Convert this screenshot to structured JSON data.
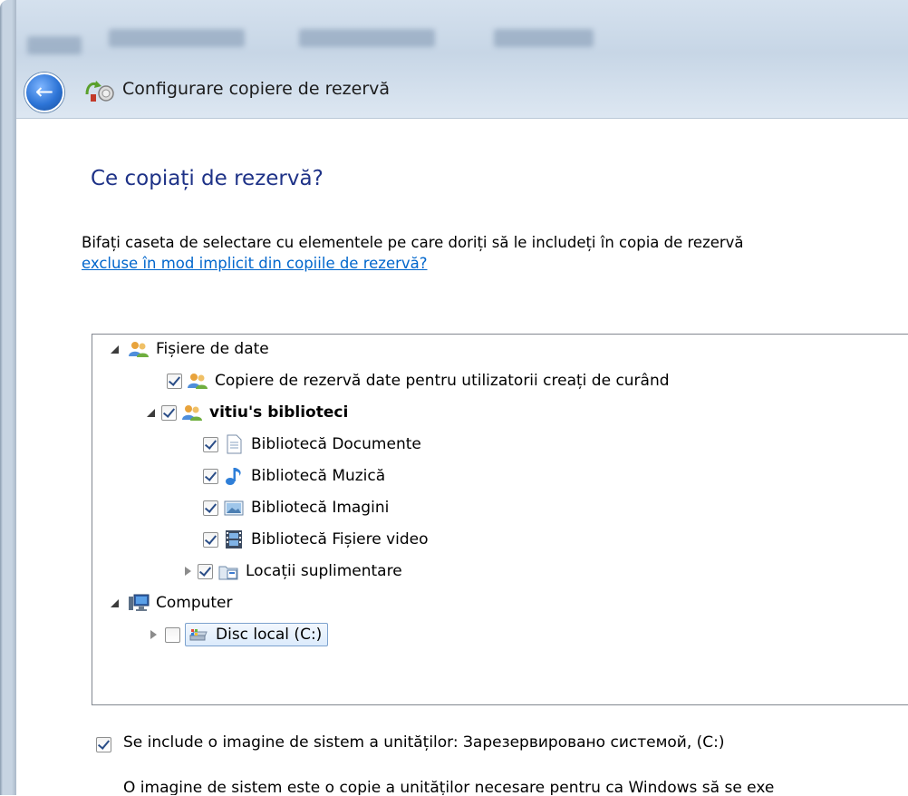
{
  "window": {
    "title": "Configurare copiere de rezervă",
    "background_blur_colors": [
      "#d5e1ee",
      "#c7d6e6"
    ]
  },
  "page": {
    "heading": "Ce copiați de rezervă?",
    "description_line1": "Bifați caseta de selectare cu elementele pe care doriți să le includeți în copia de rezervă",
    "description_link": "excluse în mod implicit din copiile de rezervă?"
  },
  "tree": {
    "items": [
      {
        "label": "Fișiere de date",
        "checked": null,
        "icon": "users-icon",
        "expander": "open"
      },
      {
        "label": "Copiere de rezervă date pentru utilizatorii creați de curând",
        "checked": true,
        "icon": "users-icon",
        "expander": "none"
      },
      {
        "label": "vitiu's biblioteci",
        "checked": true,
        "icon": "users-icon",
        "expander": "open"
      },
      {
        "label": "Bibliotecă Documente",
        "checked": true,
        "icon": "document-icon",
        "expander": "none"
      },
      {
        "label": "Bibliotecă Muzică",
        "checked": true,
        "icon": "music-note-icon",
        "expander": "none"
      },
      {
        "label": "Bibliotecă Imagini",
        "checked": true,
        "icon": "picture-icon",
        "expander": "none"
      },
      {
        "label": "Bibliotecă Fișiere video",
        "checked": true,
        "icon": "film-icon",
        "expander": "none"
      },
      {
        "label": "Locații suplimentare",
        "checked": true,
        "icon": "folder-locations-icon",
        "expander": "closed"
      },
      {
        "label": "Computer",
        "checked": null,
        "icon": "computer-icon",
        "expander": "open"
      },
      {
        "label": "Disc local (C:)",
        "checked": false,
        "icon": "drive-icon",
        "expander": "closed",
        "selected": true
      }
    ]
  },
  "options": {
    "system_image_label": "Se include o imagine de sistem a unităților: Зарезервировано системой, (C:)",
    "system_image_checked": true,
    "system_image_note": "O imagine de sistem este o copie a unităților necesare pentru ca Windows să se exe"
  },
  "colors": {
    "heading": "#1e3287",
    "link": "#0066cc",
    "selection_border": "#7da2ce"
  }
}
